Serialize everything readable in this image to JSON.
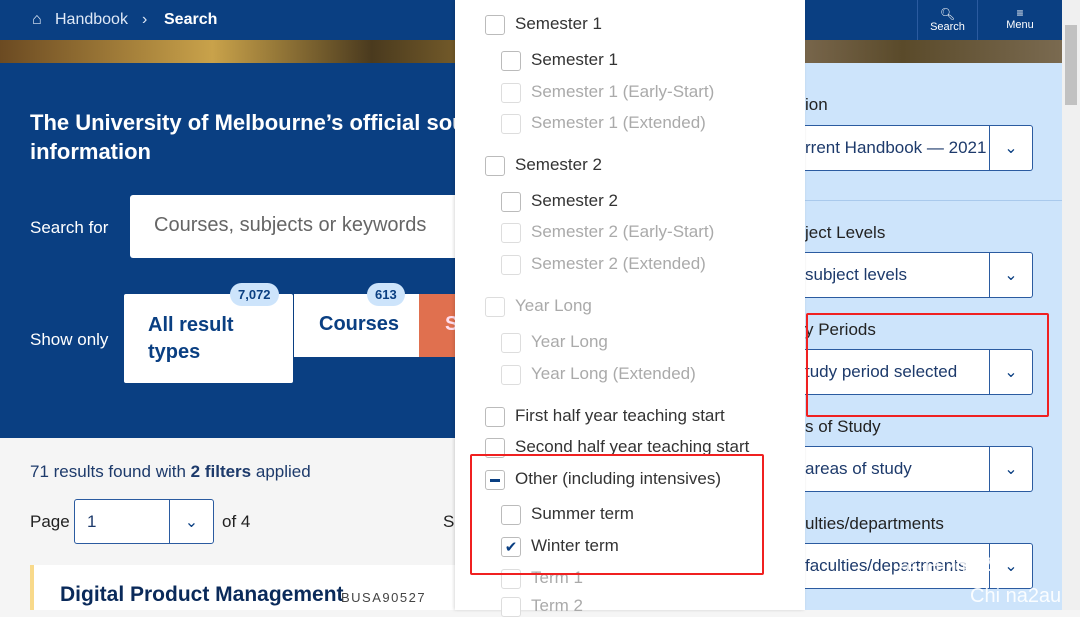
{
  "nav": {
    "home": "Handbook",
    "current": "Search",
    "search_label": "Search",
    "menu_label": "Menu"
  },
  "hero": {
    "title_line1": "The University of Melbourne’s official sou",
    "title_line2": "information",
    "search_label": "Search for",
    "search_placeholder": "Courses, subjects or keywords",
    "show_only": "Show only",
    "tabs": [
      {
        "label": "All result types",
        "count": "7,072"
      },
      {
        "label": "Courses",
        "count": "613"
      },
      {
        "label": "S"
      }
    ]
  },
  "results": {
    "count_prefix": "71 results found with ",
    "filters": "2 filters",
    "suffix": " applied",
    "page_label": "Page",
    "page_value": "1",
    "of": "of 4",
    "sort_partial": "So"
  },
  "card": {
    "title": "Digital Product Management",
    "code": "BUSA90527"
  },
  "study_periods": [
    {
      "label": "Semester 1",
      "level": 0,
      "state": "unchecked"
    },
    {
      "label": "Semester 1",
      "level": 1,
      "state": "unchecked"
    },
    {
      "label": "Semester 1 (Early-Start)",
      "level": 1,
      "state": "disabled"
    },
    {
      "label": "Semester 1 (Extended)",
      "level": 1,
      "state": "disabled"
    },
    {
      "label": "Semester 2",
      "level": 0,
      "state": "unchecked"
    },
    {
      "label": "Semester 2",
      "level": 1,
      "state": "unchecked"
    },
    {
      "label": "Semester 2 (Early-Start)",
      "level": 1,
      "state": "disabled"
    },
    {
      "label": "Semester 2 (Extended)",
      "level": 1,
      "state": "disabled"
    },
    {
      "label": "Year Long",
      "level": 0,
      "state": "disabled"
    },
    {
      "label": "Year Long",
      "level": 1,
      "state": "disabled"
    },
    {
      "label": "Year Long (Extended)",
      "level": 1,
      "state": "disabled"
    },
    {
      "label": "First half year teaching start",
      "level": 0,
      "state": "unchecked"
    },
    {
      "label": "Second half year teaching start",
      "level": 0,
      "state": "unchecked"
    },
    {
      "label": "Other (including intensives)",
      "level": 0,
      "state": "indeterminate"
    },
    {
      "label": "Summer term",
      "level": 1,
      "state": "unchecked"
    },
    {
      "label": "Winter term",
      "level": 1,
      "state": "checked"
    },
    {
      "label": "Term 1",
      "level": 1,
      "state": "disabled"
    },
    {
      "label": "Term 2",
      "level": 1,
      "state": "disabled"
    }
  ],
  "sidebar": {
    "filters": [
      {
        "label": "ion",
        "value": "rrent Handbook — 2021"
      },
      {
        "label": "ject Levels",
        "value": " subject levels"
      },
      {
        "label": "y Periods",
        "value": "tudy period selected"
      },
      {
        "label": "s of Study",
        "value": " areas of study"
      },
      {
        "label": "ulties/departments",
        "value": " faculties/departments"
      }
    ]
  },
  "watermark": {
    "text1": "学在猫本",
    "text2": "Chi na2au"
  },
  "colors": {
    "primary": "#0a3f82",
    "sidebar": "#cde4fb",
    "accent_tab": "#e0704f",
    "highlight": "#f02020"
  }
}
